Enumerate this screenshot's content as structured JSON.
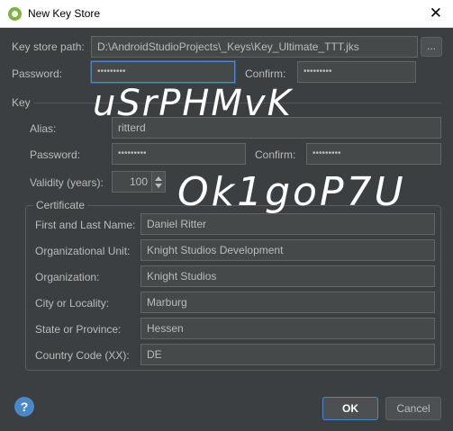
{
  "window": {
    "title": "New Key Store",
    "close_glyph": "✕"
  },
  "keystore": {
    "path_label": "Key store path:",
    "path_value": "D:\\AndroidStudioProjects\\_Keys\\Key_Ultimate_TTT.jks",
    "browse_label": "...",
    "password_label": "Password:",
    "password_value": "•••••••••",
    "confirm_label": "Confirm:",
    "confirm_value": "•••••••••"
  },
  "key": {
    "section_label": "Key",
    "alias_label": "Alias:",
    "alias_value": "ritterd",
    "password_label": "Password:",
    "password_value": "•••••••••",
    "confirm_label": "Confirm:",
    "confirm_value": "•••••••••",
    "validity_label": "Validity (years):",
    "validity_value": "100"
  },
  "certificate": {
    "section_label": "Certificate",
    "fields": [
      {
        "label": "First and Last Name:",
        "value": "Daniel Ritter"
      },
      {
        "label": "Organizational Unit:",
        "value": "Knight Studios Development"
      },
      {
        "label": "Organization:",
        "value": "Knight Studios"
      },
      {
        "label": "City or Locality:",
        "value": "Marburg"
      },
      {
        "label": "State or Province:",
        "value": "Hessen"
      },
      {
        "label": "Country Code (XX):",
        "value": "DE"
      }
    ]
  },
  "footer": {
    "help_glyph": "?",
    "ok_label": "OK",
    "cancel_label": "Cancel"
  },
  "overlay": {
    "scribble_1": "uSrPHMvK",
    "scribble_2": "Ok1goP7U"
  },
  "colors": {
    "background": "#3c3f41",
    "field": "#45494a",
    "accent": "#4a88c7",
    "text": "#bbbbbb"
  }
}
